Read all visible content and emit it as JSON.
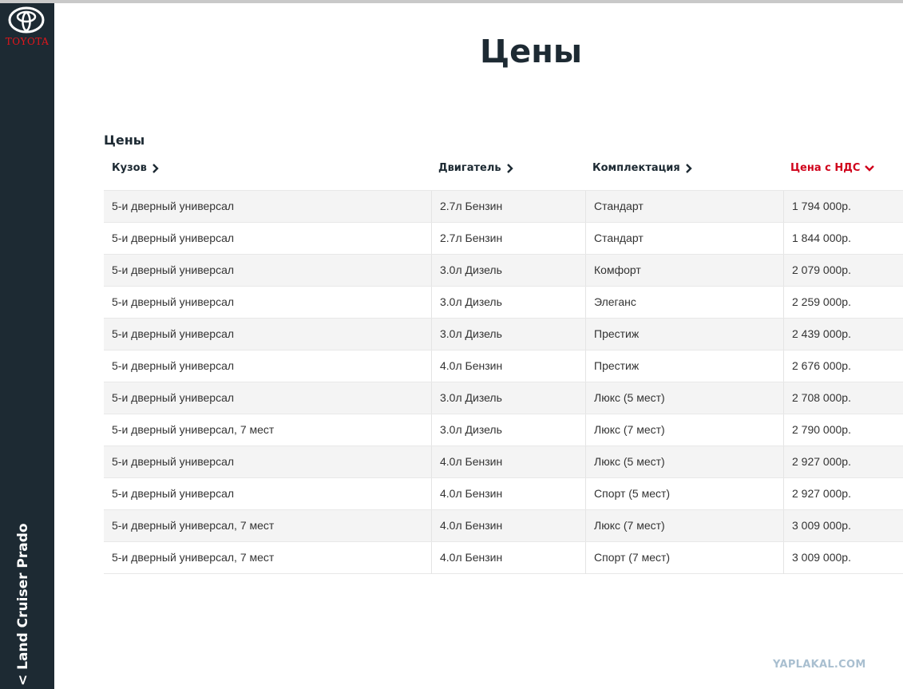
{
  "brand": {
    "logo_text": "TOYOTA",
    "logo_color": "#e3161b",
    "sidebar_color": "#1d2a33"
  },
  "sidebar": {
    "back_label": "< Land Cruiser Prado"
  },
  "page": {
    "title": "Цены",
    "section_title": "Цены"
  },
  "table": {
    "headers": [
      {
        "label": "Кузов",
        "icon": "chevron-right-icon",
        "active": false
      },
      {
        "label": "Двигатель",
        "icon": "chevron-right-icon",
        "active": false
      },
      {
        "label": "Комплектация",
        "icon": "chevron-right-icon",
        "active": false
      },
      {
        "label": "Цена с НДС",
        "icon": "chevron-down-icon",
        "active": true
      }
    ],
    "active_color": "#d0021b",
    "rows": [
      [
        "5-и дверный универсал",
        "2.7л Бензин",
        "Стандарт",
        "1 794 000р."
      ],
      [
        "5-и дверный универсал",
        "2.7л Бензин",
        "Стандарт",
        "1 844 000р."
      ],
      [
        "5-и дверный универсал",
        "3.0л Дизель",
        "Комфорт",
        "2 079 000р."
      ],
      [
        "5-и дверный универсал",
        "3.0л Дизель",
        "Элеганс",
        "2 259 000р."
      ],
      [
        "5-и дверный универсал",
        "3.0л Дизель",
        "Престиж",
        "2 439 000р."
      ],
      [
        "5-и дверный универсал",
        "4.0л Бензин",
        "Престиж",
        "2 676 000р."
      ],
      [
        "5-и дверный универсал",
        "3.0л Дизель",
        "Люкс (5 мест)",
        "2 708 000р."
      ],
      [
        "5-и дверный универсал, 7 мест",
        "3.0л Дизель",
        "Люкс (7 мест)",
        "2 790 000р."
      ],
      [
        "5-и дверный универсал",
        "4.0л Бензин",
        "Люкс (5 мест)",
        "2 927 000р."
      ],
      [
        "5-и дверный универсал",
        "4.0л Бензин",
        "Спорт (5 мест)",
        "2 927 000р."
      ],
      [
        "5-и дверный универсал, 7 мест",
        "4.0л Бензин",
        "Люкс (7 мест)",
        "3 009 000р."
      ],
      [
        "5-и дверный универсал, 7 мест",
        "4.0л Бензин",
        "Спорт (7 мест)",
        "3 009 000р."
      ]
    ]
  },
  "watermark": "YAPLAKAL.COM"
}
